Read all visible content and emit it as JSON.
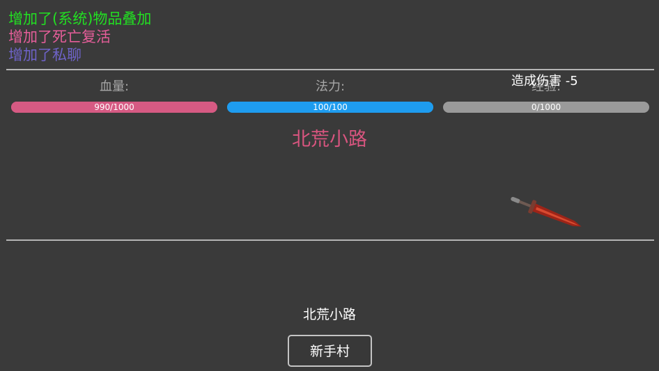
{
  "log": [
    {
      "text": "增加了(系统)物品叠加",
      "color": "#22e022"
    },
    {
      "text": "增加了死亡复活",
      "color": "#e65e9a"
    },
    {
      "text": "增加了私聊",
      "color": "#6e63c8"
    }
  ],
  "stats": {
    "hp": {
      "label": "血量:",
      "value": 990,
      "max": 1000,
      "text": "990/1000",
      "color": "#d65a83"
    },
    "mp": {
      "label": "法力:",
      "value": 100,
      "max": 100,
      "text": "100/100",
      "color": "#1e9cef"
    },
    "xp": {
      "label": "经验:",
      "value": 0,
      "max": 1000,
      "text": "0/1000",
      "color": "#9a9a9a"
    }
  },
  "location_title": "北荒小路",
  "damage_popup": "造成伤害 -5",
  "enemy_icon": "sword-icon",
  "current_place": "北荒小路",
  "nav_button": "新手村"
}
